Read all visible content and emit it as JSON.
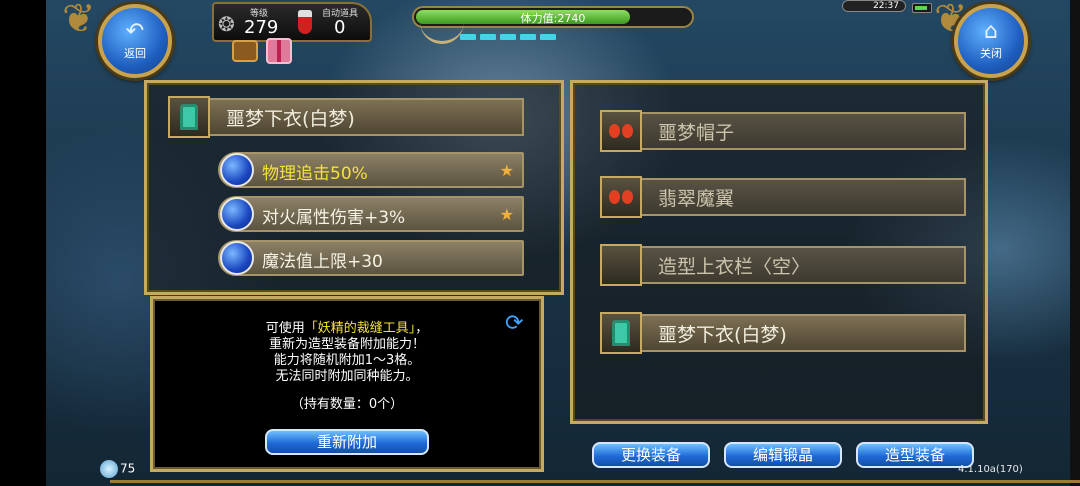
{
  "hud": {
    "back_label": "返回",
    "close_label": "关闭",
    "level_label": "等级",
    "level_value": "279",
    "auto_potion_label": "自动道具",
    "auto_potion_value": "0",
    "stamina_text": "体力值:2740",
    "stamina_fraction": 0.78,
    "clock": "22:37",
    "bottom_left_value": "75",
    "version": "4.1.10a(170)"
  },
  "left_panel": {
    "equipped_item": "噩梦下衣(白梦)",
    "abilities": [
      {
        "text": "物理追击50%",
        "starred": true,
        "highlight": true
      },
      {
        "text": "对火属性伤害+3%",
        "starred": true,
        "highlight": false
      },
      {
        "text": "魔法值上限+30",
        "starred": false,
        "highlight": false
      }
    ]
  },
  "info_box": {
    "line1_prefix": "可使用",
    "line1_item": "「妖精的裁缝工具」",
    "line1_suffix": "，",
    "line2": "重新为造型装备附加能力！",
    "line3": "能力将随机附加1～3格。",
    "line4": "无法同时附加同种能力。",
    "owned": "（持有数量：0个）",
    "reattach_button": "重新附加"
  },
  "right_panel": {
    "slots": [
      {
        "name": "噩梦帽子",
        "icon": "bow-icon",
        "dim": true
      },
      {
        "name": "翡翠魔翼",
        "icon": "bow-icon",
        "dim": true
      },
      {
        "name": "造型上衣栏〈空〉",
        "icon": "",
        "dim": true
      },
      {
        "name": "噩梦下衣(白梦)",
        "icon": "armor-icon",
        "dim": false
      }
    ]
  },
  "bottom_buttons": {
    "change_equipment": "更换装备",
    "edit_crystal": "编辑锻晶",
    "costume_equipment": "造型装备"
  }
}
